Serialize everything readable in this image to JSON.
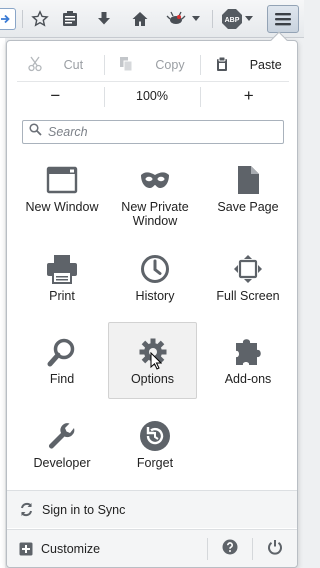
{
  "toolbar": {
    "icons": [
      "go-arrow-icon",
      "star-icon",
      "reading-list-icon",
      "download-icon",
      "home-icon",
      "extension-icon",
      "dropdown-icon",
      "adblock-icon",
      "dropdown-icon",
      "hamburger-menu-icon"
    ],
    "adblock_text": "ABP"
  },
  "menu_panel": {
    "edit": {
      "cut_label": "Cut",
      "copy_label": "Copy",
      "paste_label": "Paste"
    },
    "zoom": {
      "minus_label": "−",
      "level": "100%",
      "plus_label": "+"
    },
    "search": {
      "placeholder": "Search"
    },
    "items": [
      {
        "label": "New Window",
        "icon": "new-window-icon"
      },
      {
        "label": "New Private Window",
        "icon": "private-mask-icon"
      },
      {
        "label": "Save Page",
        "icon": "save-page-icon"
      },
      {
        "label": "Print",
        "icon": "printer-icon"
      },
      {
        "label": "History",
        "icon": "clock-icon"
      },
      {
        "label": "Full Screen",
        "icon": "fullscreen-icon"
      },
      {
        "label": "Find",
        "icon": "magnifier-icon"
      },
      {
        "label": "Options",
        "icon": "gear-icon",
        "hovered": true
      },
      {
        "label": "Add-ons",
        "icon": "puzzle-icon"
      },
      {
        "label": "Developer",
        "icon": "wrench-icon"
      },
      {
        "label": "Forget",
        "icon": "forget-icon"
      }
    ],
    "sync_label": "Sign in to Sync",
    "customize_label": "Customize"
  },
  "colors": {
    "icon_gray": "#5e6369",
    "disabled_gray": "#9a9ea3",
    "hover_bg": "#f1f1f1"
  }
}
